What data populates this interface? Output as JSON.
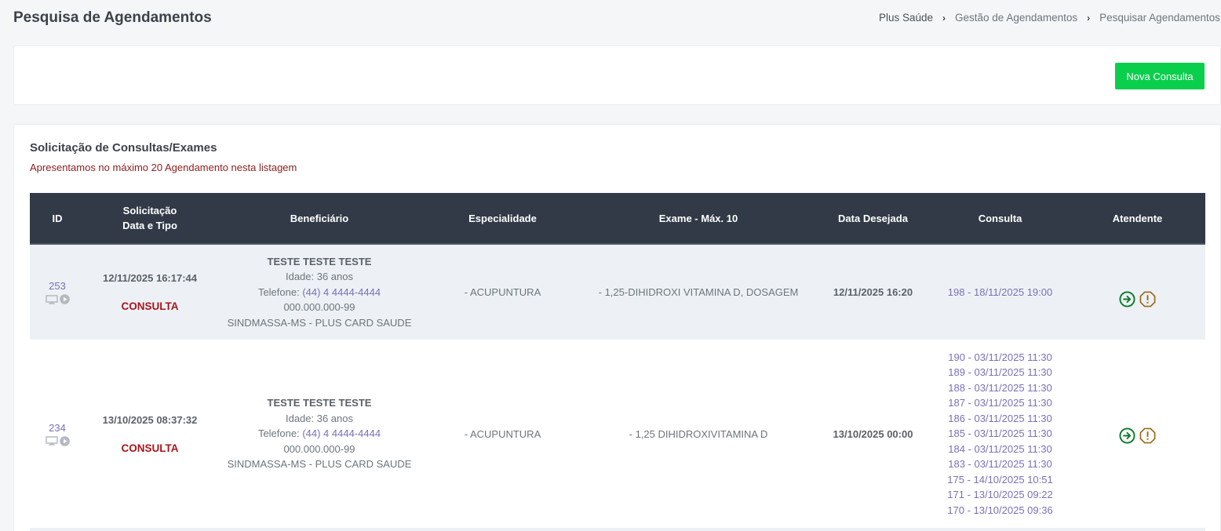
{
  "header": {
    "title": "Pesquisa de Agendamentos",
    "breadcrumb": [
      "Plus Saúde",
      "Gestão de Agendamentos",
      "Pesquisar Agendamentos"
    ]
  },
  "toolbar": {
    "new_button": "Nova Consulta"
  },
  "section": {
    "title": "Solicitação de Consultas/Exames",
    "note": "Apresentamos no máximo 20 Agendamento nesta listagem"
  },
  "table": {
    "headers": {
      "id": "ID",
      "sol_line1": "Solicitação",
      "sol_line2": "Data e Tipo",
      "beneficiario": "Beneficiário",
      "especialidade": "Especialidade",
      "exame": "Exame - Máx. 10",
      "data": "Data Desejada",
      "consulta": "Consulta",
      "atendente": "Atendente"
    },
    "rows": [
      {
        "id": "253",
        "date": "12/11/2025 16:17:44",
        "type": "CONSULTA",
        "name": "TESTE TESTE TESTE",
        "age": "Idade: 36 anos",
        "phone_label": "Telefone: ",
        "phone": "(44) 4 4444-4444",
        "doc": "000.000.000-99",
        "plan": "SINDMASSA-MS - PLUS CARD SAUDE",
        "specialty": "- ACUPUNTURA",
        "exam": "- 1,25-DIHIDROXI VITAMINA D, DOSAGEM",
        "desired": "12/11/2025 16:20",
        "consultas": [
          "198 - 18/11/2025 19:00"
        ]
      },
      {
        "id": "234",
        "date": "13/10/2025 08:37:32",
        "type": "CONSULTA",
        "name": "TESTE TESTE TESTE",
        "age": "Idade: 36 anos",
        "phone_label": "Telefone: ",
        "phone": "(44) 4 4444-4444",
        "doc": "000.000.000-99",
        "plan": "SINDMASSA-MS - PLUS CARD SAUDE",
        "specialty": "- ACUPUNTURA",
        "exam": "- 1,25 DIHIDROXIVITAMINA D",
        "desired": "13/10/2025 00:00",
        "consultas": [
          "190 - 03/11/2025 11:30",
          "189 - 03/11/2025 11:30",
          "188 - 03/11/2025 11:30",
          "187 - 03/11/2025 11:30",
          "186 - 03/11/2025 11:30",
          "185 - 03/11/2025 11:30",
          "184 - 03/11/2025 11:30",
          "183 - 03/11/2025 11:30",
          "175 - 14/10/2025 10:51",
          "171 - 13/10/2025 09:22",
          "170 - 13/10/2025 09:36"
        ]
      }
    ]
  },
  "colors": {
    "accent_green": "#0acf4c",
    "header_dark": "#313a46",
    "link_purple": "#7a70b8",
    "type_red": "#a8161c",
    "action_green": "#0a7a2a",
    "action_warn": "#9a6a1a"
  },
  "icons": {
    "id_icons": [
      "monitor-icon",
      "play-icon"
    ],
    "actions": [
      "arrow-right-circle-icon",
      "alert-octagon-icon"
    ]
  }
}
